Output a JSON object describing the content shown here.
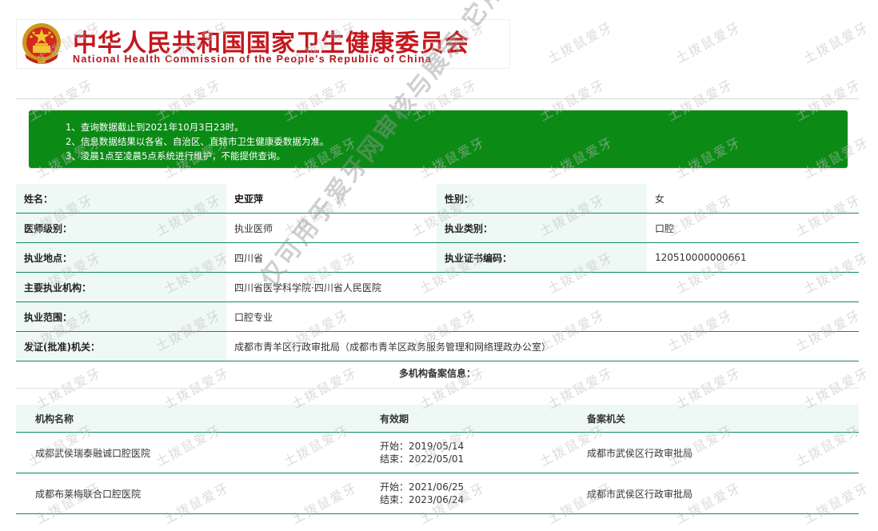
{
  "header": {
    "cn_title": "中华人民共和国国家卫生健康委员会",
    "en_title": "National Health Commission of the People's Republic of China",
    "emblem_icon": "national-emblem-icon"
  },
  "notice": {
    "items": [
      "1、查询数据截止到2021年10月3日23时。",
      "2、信息数据结果以各省、自治区、直辖市卫生健康委数据为准。",
      "3、凌晨1点至凌晨5点系统进行维护，不能提供查询。"
    ],
    "bg_color": "#0c8a16"
  },
  "info": {
    "name_label": "姓名：",
    "name_value": "史亚萍",
    "gender_label": "性别：",
    "gender_value": "女",
    "level_label": "医师级别：",
    "level_value": "执业医师",
    "category_label": "执业类别：",
    "category_value": "口腔",
    "location_label": "执业地点：",
    "location_value": "四川省",
    "cert_label": "执业证书编码：",
    "cert_value": "120510000000661",
    "org_label": "主要执业机构：",
    "org_value": "四川省医学科学院·四川省人民医院",
    "scope_label": "执业范围：",
    "scope_value": "口腔专业",
    "issuer_label": "发证(批准)机关：",
    "issuer_value": "成都市青羊区行政审批局（成都市青羊区政务服务管理和网络理政办公室）"
  },
  "multi": {
    "title": "多机构备案信息：",
    "headers": [
      "机构名称",
      "有效期",
      "备案机关"
    ],
    "rows": [
      {
        "org": "成都武侯瑞泰融诚口腔医院",
        "start": "开始：2019/05/14",
        "end": "结束：2022/05/01",
        "authority": "成都市武侯区行政审批局"
      },
      {
        "org": "成都布莱梅联合口腔医院",
        "start": "开始：2021/06/25",
        "end": "结束：2023/06/24",
        "authority": "成都市武侯区行政审批局"
      }
    ]
  },
  "watermark": {
    "repeat_text": "土拨鼠爱牙",
    "diagonal_text": "仅可用于爱牙网审核与展示   它用无效"
  },
  "colors": {
    "brand_red": "#c3181d",
    "border_green": "#0f8a5f",
    "label_bg": "#eef8f4"
  }
}
